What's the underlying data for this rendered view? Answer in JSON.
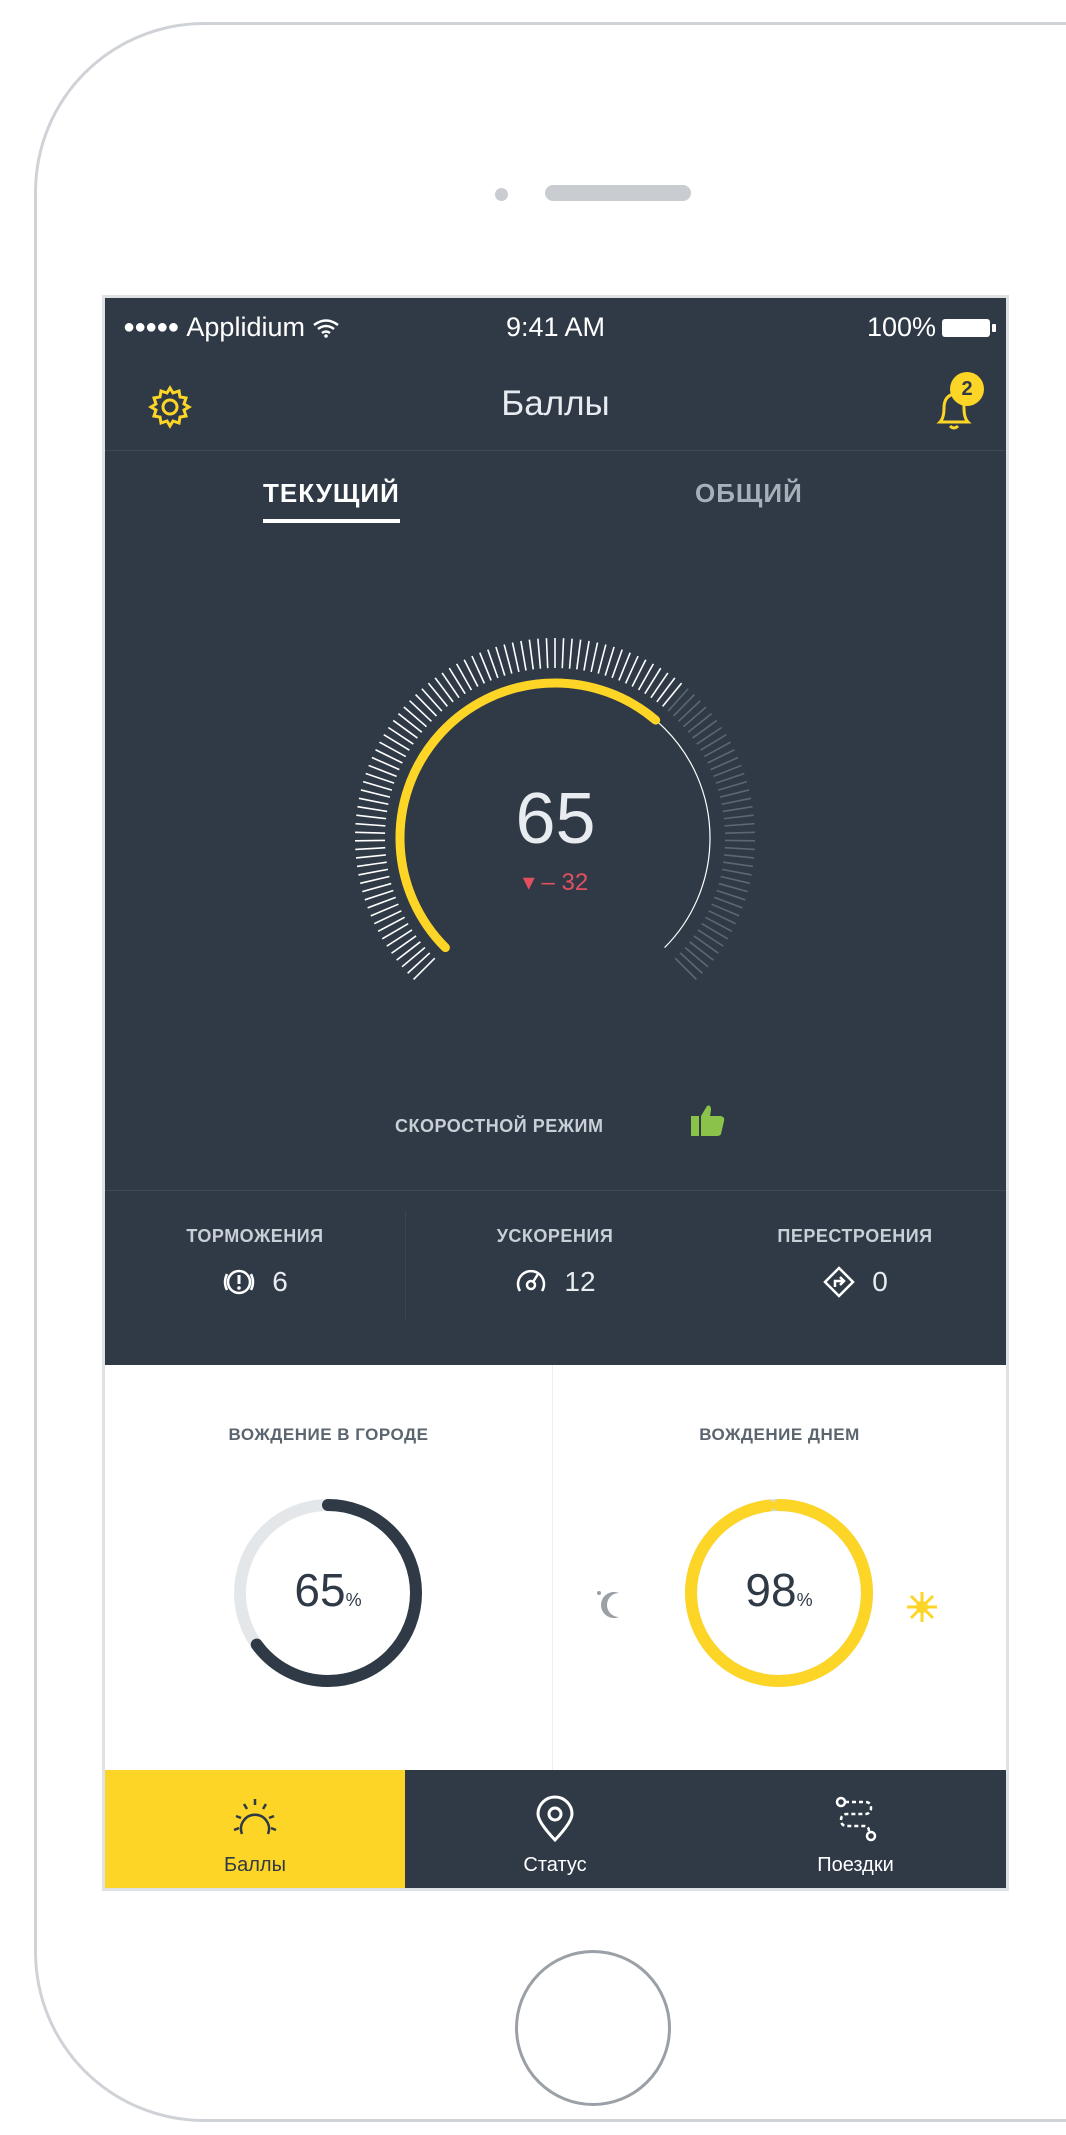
{
  "status_bar": {
    "carrier": "Applidium",
    "time": "9:41 AM",
    "battery": "100%"
  },
  "nav": {
    "title": "Баллы",
    "notification_count": "2"
  },
  "tabs": {
    "current": "ТЕКУЩИЙ",
    "total": "ОБЩИЙ"
  },
  "score": {
    "value": "65",
    "delta": "– 32",
    "fraction": 0.65
  },
  "speed_mode": {
    "label": "СКОРОСТНОЙ РЕЖИМ",
    "icon": "thumbs-up-icon"
  },
  "stats": [
    {
      "label": "ТОРМОЖЕНИЯ",
      "value": "6",
      "icon": "brake-icon"
    },
    {
      "label": "УСКОРЕНИЯ",
      "value": "12",
      "icon": "speedometer-icon"
    },
    {
      "label": "ПЕРЕСТРОЕНИЯ",
      "value": "0",
      "icon": "lane-change-icon"
    }
  ],
  "city_driving": {
    "label": "ВОЖДЕНИЕ В ГОРОДЕ",
    "value": "65",
    "unit": "%",
    "fraction": 0.65
  },
  "day_driving": {
    "label": "ВОЖДЕНИЕ ДНЕМ",
    "value": "98",
    "unit": "%",
    "fraction": 0.98
  },
  "tabbar": [
    {
      "label": "Баллы",
      "icon": "gauge-icon",
      "active": true
    },
    {
      "label": "Статус",
      "icon": "location-pin-icon",
      "active": false
    },
    {
      "label": "Поездки",
      "icon": "route-icon",
      "active": false
    }
  ],
  "colors": {
    "dark": "#2f3a46",
    "accent": "#fdd527",
    "negative": "#e2505f",
    "positive": "#8bc34a"
  }
}
